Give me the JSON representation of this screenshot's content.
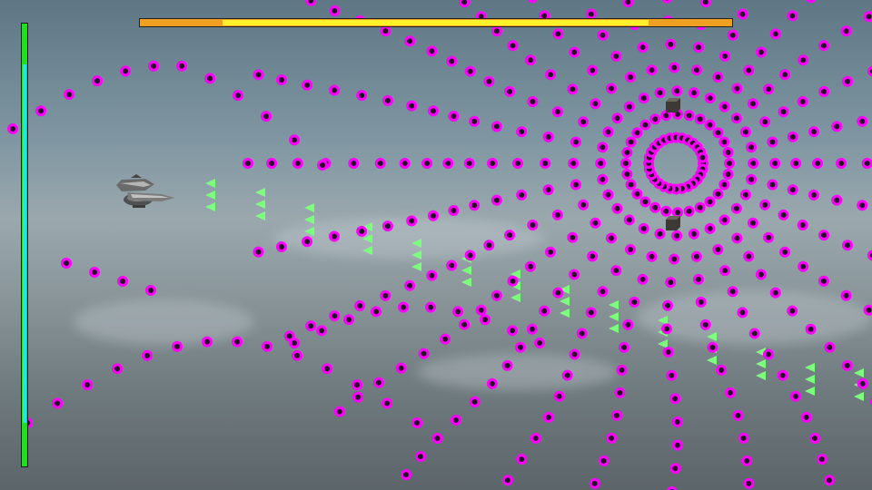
{
  "game": {
    "boss_health_fraction": 0.72,
    "player_health_fraction": 0.81,
    "colors": {
      "boss_bar_outer": "#f0a020",
      "boss_bar_fill": "#fff22a",
      "player_bar_outer": "#22dd22",
      "player_bar_fill": "#22e6e6",
      "enemy_bullet": "#ff00ff",
      "player_shot": "#7cff7c"
    },
    "icons": {
      "player": "player-airship-icon",
      "turret": "turret-block-icon",
      "enemy_bullet": "ring-bullet-icon",
      "player_shot": "arrow-shot-icon"
    }
  }
}
